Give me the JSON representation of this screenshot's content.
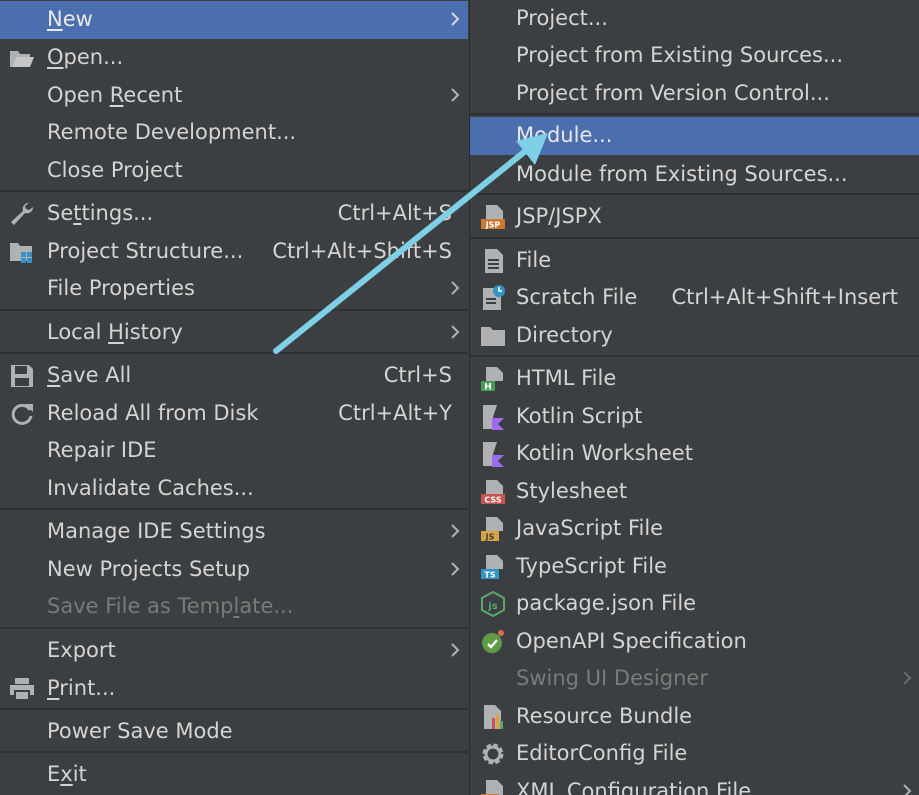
{
  "left_menu": {
    "new": {
      "pre": "",
      "u": "N",
      "post": "ew"
    },
    "open": {
      "pre": "",
      "u": "O",
      "post": "pen..."
    },
    "open_recent": {
      "pre": "Open ",
      "u": "R",
      "post": "ecent"
    },
    "remote_development": "Remote Development...",
    "close_project": "Close Project",
    "settings": {
      "pre": "Se",
      "u": "t",
      "post": "tings..."
    },
    "settings_shortcut": "Ctrl+Alt+S",
    "project_structure": "Project Structure...",
    "project_structure_shortcut": "Ctrl+Alt+Shift+S",
    "file_properties": "File Properties",
    "local_history": {
      "pre": "Local ",
      "u": "H",
      "post": "istory"
    },
    "save_all": {
      "pre": "",
      "u": "S",
      "post": "ave All"
    },
    "save_all_shortcut": "Ctrl+S",
    "reload_all": "Reload All from Disk",
    "reload_all_shortcut": "Ctrl+Alt+Y",
    "repair_ide": "Repair IDE",
    "invalidate_caches": "Invalidate Caches...",
    "manage_ide_settings": "Manage IDE Settings",
    "new_projects_setup": "New Projects Setup",
    "save_file_as_template": {
      "pre": "Save File as Temp",
      "u": "l",
      "post": "ate..."
    },
    "export": "Export",
    "print": {
      "pre": "",
      "u": "P",
      "post": "rint..."
    },
    "power_save_mode": "Power Save Mode",
    "exit": {
      "pre": "E",
      "u": "x",
      "post": "it"
    }
  },
  "right_menu": {
    "project": "Project...",
    "project_from_existing": "Project from Existing Sources...",
    "project_from_vcs": "Project from Version Control...",
    "module": "Module...",
    "module_from_existing": "Module from Existing Sources...",
    "jsp": "JSP/JSPX",
    "file": "File",
    "scratch_file": "Scratch File",
    "scratch_file_shortcut": "Ctrl+Alt+Shift+Insert",
    "directory": "Directory",
    "html_file": "HTML File",
    "kotlin_script": "Kotlin Script",
    "kotlin_worksheet": "Kotlin Worksheet",
    "stylesheet": "Stylesheet",
    "javascript_file": "JavaScript File",
    "typescript_file": "TypeScript File",
    "package_json": "package.json File",
    "openapi": "OpenAPI Specification",
    "swing_ui_designer": "Swing UI Designer",
    "resource_bundle": "Resource Bundle",
    "editorconfig": "EditorConfig File",
    "xml_config": "XML Configuration File"
  },
  "icon_badges": {
    "jsp": "JSP",
    "html": "H",
    "css": "CSS",
    "js": "JS",
    "ts": "TS"
  },
  "colors": {
    "menu_bg": "#3c3f41",
    "highlight": "#4b6eaf",
    "text": "#d4d4d4",
    "disabled_text": "#7a7a7a",
    "annotation_arrow": "#7fd0e6"
  }
}
